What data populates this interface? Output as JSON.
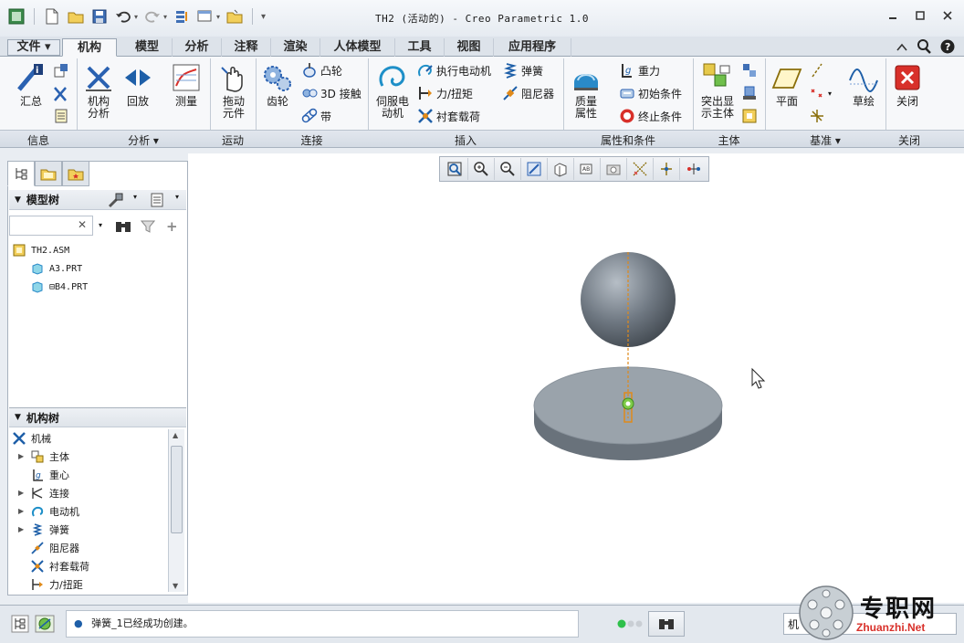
{
  "window": {
    "title": "TH2 (活动的) - Creo Parametric 1.0"
  },
  "tabs": [
    {
      "label": "文件 ▾"
    },
    {
      "label": "机构"
    },
    {
      "label": "模型"
    },
    {
      "label": "分析"
    },
    {
      "label": "注释"
    },
    {
      "label": "渲染"
    },
    {
      "label": "人体模型"
    },
    {
      "label": "工具"
    },
    {
      "label": "视图"
    },
    {
      "label": "应用程序"
    }
  ],
  "ribbon": {
    "info": {
      "summary": "汇总",
      "group": "信息"
    },
    "analysis": {
      "mech_analysis": "机构\n分析",
      "playback": "回放",
      "measure": "测量",
      "group": "分析 ▾"
    },
    "motion": {
      "drag": "拖动\n元件",
      "group": "运动"
    },
    "connect": {
      "gear": "齿轮",
      "cam": "凸轮",
      "contact3d": "3D 接触",
      "belt": "带",
      "group": "连接"
    },
    "insert": {
      "servo": "伺服电\n动机",
      "actuator": "执行电动机",
      "force": "力/扭矩",
      "bushing": "衬套载荷",
      "spring": "弹簧",
      "damper": "阻尼器",
      "group": "插入"
    },
    "props": {
      "mass": "质量\n属性",
      "gravity": "重力",
      "init": "初始条件",
      "term": "终止条件",
      "group": "属性和条件"
    },
    "body": {
      "highlight": "突出显\n示主体",
      "group": "主体"
    },
    "datum": {
      "plane": "平面",
      "sketch": "草绘",
      "group": "基准 ▾"
    },
    "close": {
      "label": "关闭",
      "group": "关闭"
    }
  },
  "model_tree": {
    "title": "模型树",
    "search_placeholder": "",
    "items": [
      {
        "label": "TH2.ASM"
      },
      {
        "label": "A3.PRT"
      },
      {
        "label": "⊟B4.PRT"
      }
    ]
  },
  "mech_tree": {
    "title": "机构树",
    "items": [
      {
        "label": "机械"
      },
      {
        "label": "主体"
      },
      {
        "label": "重心"
      },
      {
        "label": "连接"
      },
      {
        "label": "电动机"
      },
      {
        "label": "弹簧"
      },
      {
        "label": "阻尼器"
      },
      {
        "label": "衬套载荷"
      },
      {
        "label": "力/扭距"
      }
    ]
  },
  "status": {
    "message": "弹簧_1已经成功创建。",
    "right_text": "机"
  },
  "watermark": {
    "cn": "专职网",
    "en": "Zhuanzhi.Net"
  },
  "colors": {
    "accent_blue": "#1e5fa8",
    "close_red": "#d8302a",
    "model_gray": "#8a939c",
    "orange_axis": "#e08a1a"
  }
}
